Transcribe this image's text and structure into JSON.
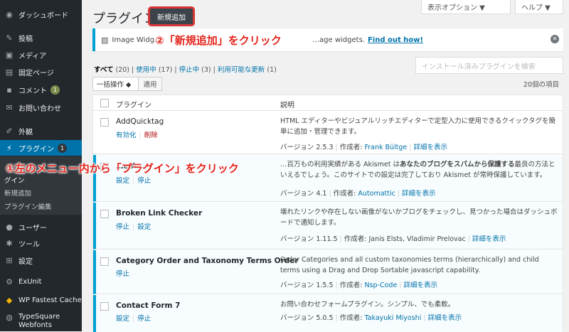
{
  "sidebar": {
    "items": [
      {
        "label": "ダッシュボード",
        "icon": "dashboard-icon"
      },
      {
        "label": "投稿",
        "icon": "pin-icon"
      },
      {
        "label": "メディア",
        "icon": "media-icon"
      },
      {
        "label": "固定ページ",
        "icon": "page-icon"
      },
      {
        "label": "コメント",
        "icon": "comment-icon",
        "badge": "1"
      },
      {
        "label": "お問い合わせ",
        "icon": "mail-icon"
      },
      {
        "label": "外観",
        "icon": "brush-icon"
      },
      {
        "label": "プラグイン",
        "icon": "plugin-icon",
        "badge": "1"
      },
      {
        "label": "ユーザー",
        "icon": "user-icon"
      },
      {
        "label": "ツール",
        "icon": "tool-icon"
      },
      {
        "label": "設定",
        "icon": "settings-icon"
      },
      {
        "label": "ExUnit",
        "icon": "gear-icon"
      },
      {
        "label": "WP Fastest Cache",
        "icon": "cheetah-icon"
      },
      {
        "label": "TypeSquare Webfonts",
        "icon": "typesquare-icon"
      }
    ],
    "submenu": [
      "グイン",
      "新規追加",
      "プラグイン編集"
    ]
  },
  "header": {
    "title": "プラグイン",
    "add_new": "新規追加",
    "screen_options": "表示オプション ▼",
    "help": "ヘルプ ▼"
  },
  "notice": {
    "text": "Image Widg…",
    "text_end": "…age widgets.",
    "link": "Find out how!"
  },
  "annotations": {
    "step2": "②「新規追加」をクリック",
    "step1": "①左のメニュー内から「プラグイン」をクリック"
  },
  "filters": {
    "all": "すべて",
    "all_count": "(20)",
    "active": "使用中",
    "active_count": "(17)",
    "inactive": "停止中",
    "inactive_count": "(3)",
    "update": "利用可能な更新",
    "update_count": "(1)"
  },
  "search": {
    "placeholder": "インストール済みプラグインを検索"
  },
  "bulk": {
    "label": "一括操作 ◆",
    "apply": "適用",
    "item_count": "20個の項目"
  },
  "table": {
    "col_plugin": "プラグイン",
    "col_desc": "説明",
    "rows": [
      {
        "name": "AddQuicktag",
        "actions": [
          "有効化",
          "削除"
        ],
        "desc": "HTML エディターやビジュアルリッチエディターで定型入力に使用できるクイックタグを簡単に追加・管理できます。",
        "version": "バージョン 2.5.3",
        "author_label": "作成者:",
        "author": "Frank Bültge",
        "details": "詳細を表示"
      },
      {
        "name": "…e A…",
        "actions": [
          "設定",
          "停止"
        ],
        "desc_pre": "…百万もの利用実績がある Akismet は",
        "desc_bold": "あなたのブログをスパムから保護する",
        "desc_post": "最良の方法といえるでしょう。このサイトでの設定は完了しており Akismet が常時保護しています。",
        "version": "バージョン 4.1",
        "author_label": "作成者:",
        "author": "Automattic",
        "details": "詳細を表示"
      },
      {
        "name": "Broken Link Checker",
        "actions": [
          "停止",
          "設定"
        ],
        "desc": "壊れたリンクや存在しない画像がないかブログをチェックし、見つかった場合はダッシュボードで通知します。",
        "version": "バージョン 1.11.5",
        "author_label": "作成者: Janis Elsts, Vladimir Prelovac",
        "details": "詳細を表示"
      },
      {
        "name": "Category Order and Taxonomy Terms Order",
        "actions": [
          "停止"
        ],
        "desc": "Order Categories and all custom taxonomies terms (hierarchically) and child terms using a Drag and Drop Sortable javascript capability.",
        "version": "バージョン 1.5.5",
        "author_label": "作成者:",
        "author": "Nsp-Code",
        "details": "詳細を表示"
      },
      {
        "name": "Contact Form 7",
        "actions": [
          "設定",
          "停止"
        ],
        "desc": "お問い合わせフォームプラグイン。シンプル、でも柔軟。",
        "version": "バージョン 5.0.5",
        "author_label": "作成者:",
        "author": "Takayuki Miyoshi",
        "details": "詳細を表示"
      }
    ]
  }
}
